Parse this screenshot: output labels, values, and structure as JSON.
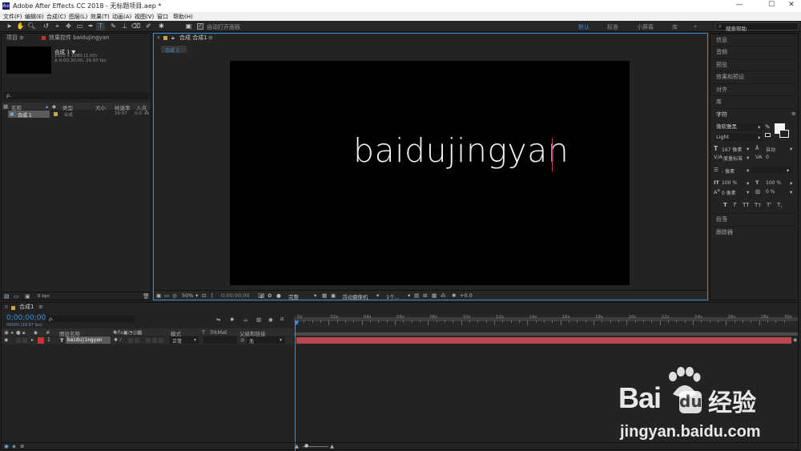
{
  "window": {
    "title": "Adobe After Effects CC 2018 - 无标题项目.aep *",
    "app_icon": "Ae",
    "min": "—",
    "max": "☐",
    "close": "✕"
  },
  "menu": [
    "文件(F)",
    "编辑(E)",
    "合成(C)",
    "图层(L)",
    "效果(T)",
    "动画(A)",
    "视图(V)",
    "窗口",
    "帮助(H)"
  ],
  "toolbar": {
    "auto_open_label": "自动打开面板",
    "workspaces": [
      "默认",
      "标准",
      "小屏幕",
      "库"
    ],
    "search_placeholder": "搜索帮助"
  },
  "project": {
    "tab": "项目",
    "effects_tab": "效果控件 baidujingyan",
    "comp_name": "合成 1 ▼",
    "comp_info1": "1920 x 1080 (1.00)",
    "comp_info2": "Δ 0;00;30;00, 29.97 fps",
    "search_icon": "ρ.",
    "columns": {
      "name": "名称",
      "type": "类型",
      "size": "大小",
      "fps": "帧速率",
      "in": "入点"
    },
    "rows": [
      {
        "name": "合成 1",
        "type": "合成",
        "fps": "29.97",
        "in": "0;0"
      }
    ],
    "bottom_bpc": "8 bpc"
  },
  "comp_viewer": {
    "tab": "合成 合成1",
    "breadcrumb": "合成 1",
    "text": "baidujingyan",
    "zoom": "50%",
    "timecode": "0;00;00;00",
    "quality": "完整",
    "camera": "活动摄像机",
    "views": "1个...",
    "exposure": "+0.0"
  },
  "right_panel": {
    "items_top": [
      "信息",
      "音频",
      "预览",
      "效果和预设",
      "对齐",
      "库"
    ],
    "character_title": "字符",
    "font": "微软雅黑",
    "style": "Light",
    "size": "167 像素",
    "leading": "自动",
    "kerning": "度量标准",
    "tracking": "0",
    "stroke": "- 像素",
    "vscale": "100 %",
    "hscale": "100 %",
    "baseline": "0 像素",
    "tsume": "0 %",
    "text_styles": [
      "T",
      "T",
      "TT",
      "Tт",
      "T'",
      "T,"
    ],
    "items_bottom": [
      "段落",
      "跟踪器"
    ]
  },
  "timeline": {
    "tab": "合成1",
    "timecode": "0;00;00;00",
    "frame_info": "00000 (29.97 fps)",
    "columns": {
      "num": "#",
      "layer_name": "图层名称",
      "mode": "模式",
      "t": "T",
      "trkmat": "TrkMat",
      "parent": "父级和链接"
    },
    "layer": {
      "num": "1",
      "type_icon": "T",
      "name": "baidujingyan",
      "mode": "正常",
      "parent": "无"
    },
    "ruler": [
      "0s",
      "02s",
      "04s",
      "06s",
      "08s",
      "10s",
      "12s",
      "14s",
      "16s",
      "18s",
      "20s",
      "22s",
      "24s",
      "26s",
      "28s",
      "30s"
    ]
  },
  "watermark": {
    "brand": "Bai",
    "brand2": "经验",
    "url": "jingyan.baidu.com"
  },
  "colors": {
    "accent": "#3b8fd9",
    "layer_bar": "#b8484e",
    "label_red": "#c83232",
    "bg": "#232323"
  }
}
